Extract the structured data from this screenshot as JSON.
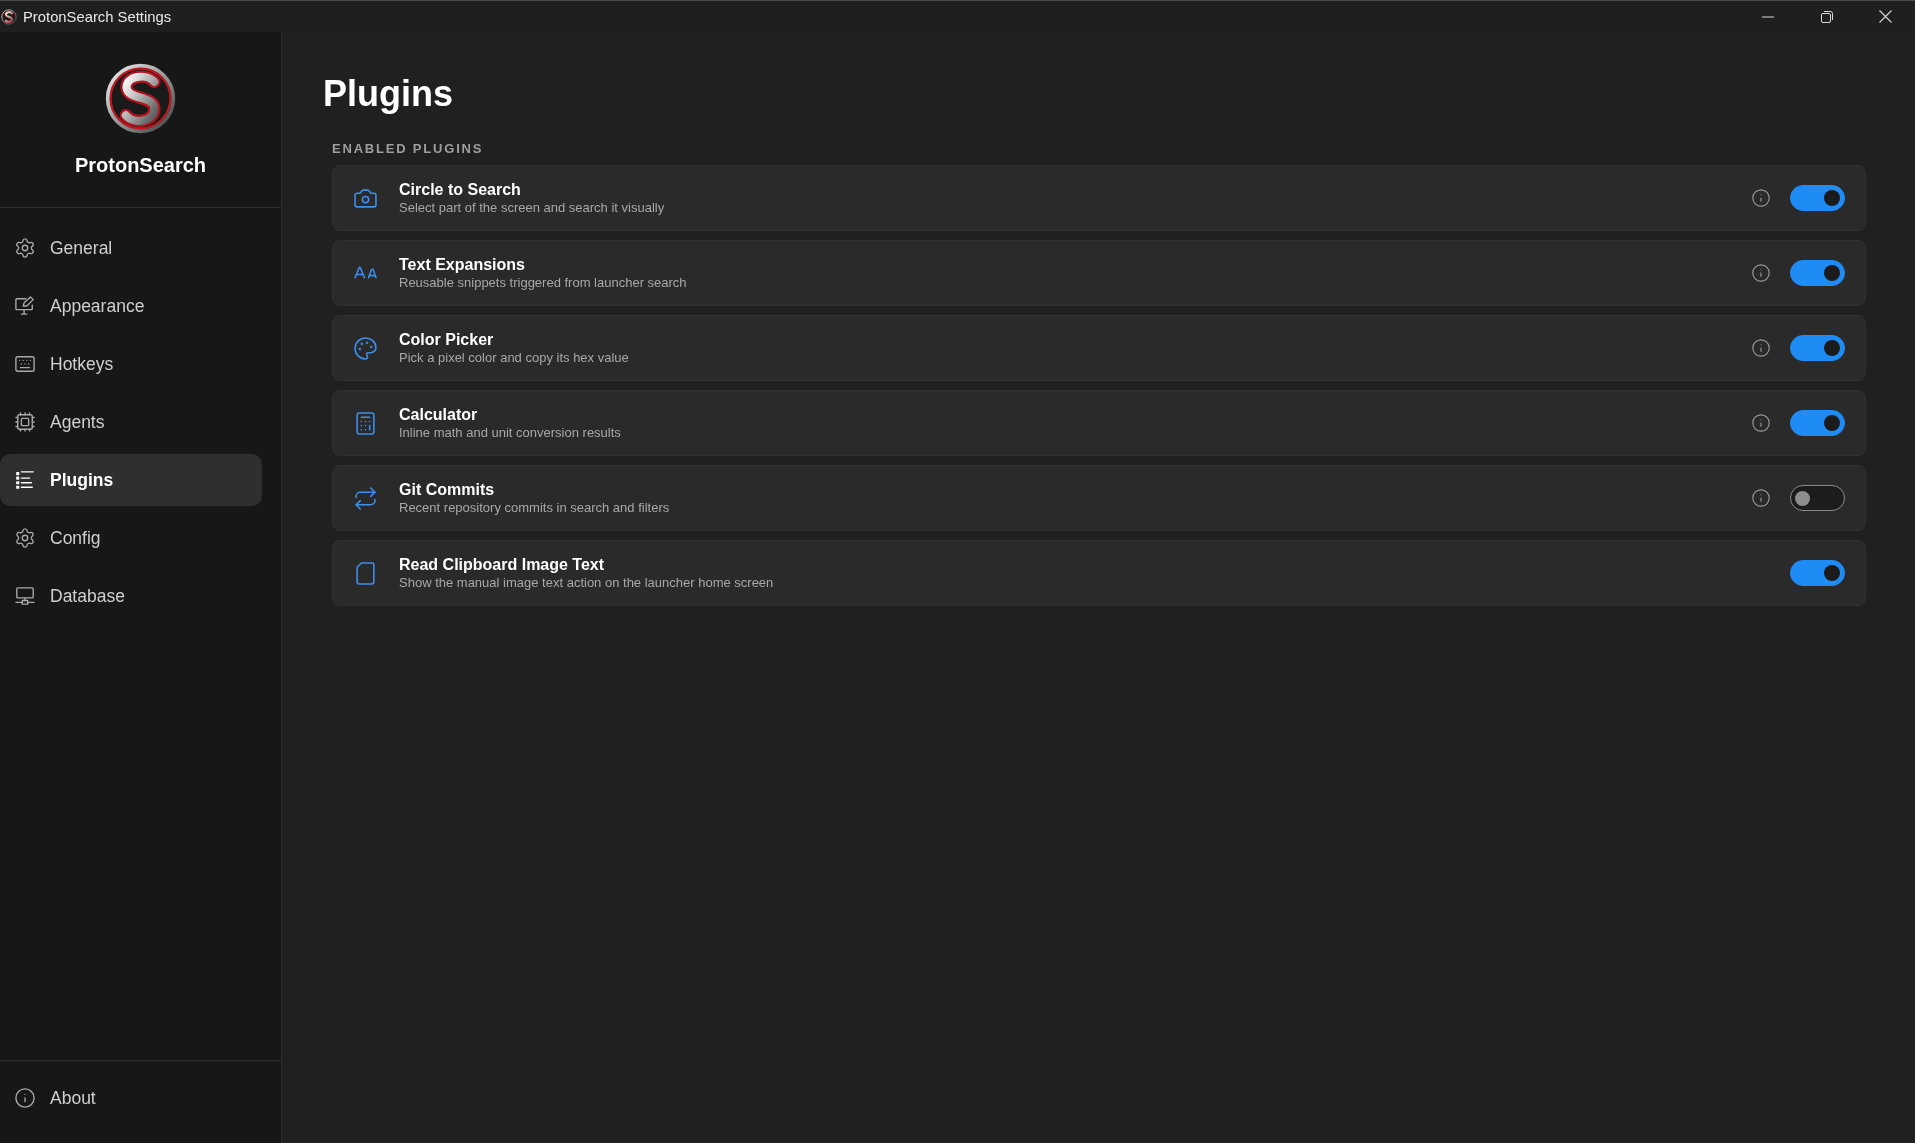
{
  "window": {
    "title": "ProtonSearch Settings"
  },
  "sidebar": {
    "app_name": "ProtonSearch",
    "items": [
      {
        "label": "General",
        "selected": false
      },
      {
        "label": "Appearance",
        "selected": false
      },
      {
        "label": "Hotkeys",
        "selected": false
      },
      {
        "label": "Agents",
        "selected": false
      },
      {
        "label": "Plugins",
        "selected": true
      },
      {
        "label": "Config",
        "selected": false
      },
      {
        "label": "Database",
        "selected": false
      }
    ],
    "footer_items": [
      {
        "label": "About",
        "selected": false
      }
    ]
  },
  "page": {
    "title": "Plugins",
    "section_title": "ENABLED PLUGINS",
    "plugins": [
      {
        "name": "Circle to Search",
        "description": "Select part of the screen and search it visually",
        "info": true,
        "enabled": true
      },
      {
        "name": "Text Expansions",
        "description": "Reusable snippets triggered from launcher search",
        "info": true,
        "enabled": true
      },
      {
        "name": "Color Picker",
        "description": "Pick a pixel color and copy its hex value",
        "info": true,
        "enabled": true
      },
      {
        "name": "Calculator",
        "description": "Inline math and unit conversion results",
        "info": true,
        "enabled": true
      },
      {
        "name": "Git Commits",
        "description": "Recent repository commits in search and filters",
        "info": true,
        "enabled": false
      },
      {
        "name": "Read Clipboard Image Text",
        "description": "Show the manual image text action on the launcher home screen",
        "info": false,
        "enabled": true
      }
    ]
  }
}
